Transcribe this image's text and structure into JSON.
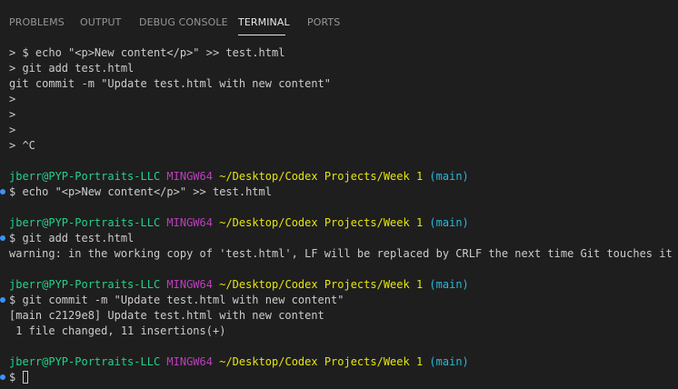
{
  "panel": {
    "tabs": [
      {
        "label": "PROBLEMS"
      },
      {
        "label": "OUTPUT"
      },
      {
        "label": "DEBUG CONSOLE"
      },
      {
        "label": "TERMINAL"
      },
      {
        "label": "PORTS"
      }
    ],
    "active_tab": "TERMINAL"
  },
  "terminal": {
    "continuation": [
      "> $ echo \"<p>New content</p>\" >> test.html",
      "> git add test.html",
      "git commit -m \"Update test.html with new content\"",
      ">",
      ">",
      ">",
      "> ^C"
    ],
    "prompt": {
      "user": "jberr@PYP-Portraits-LLC",
      "env": "MINGW64",
      "path": "~/Desktop/Codex Projects/Week 1",
      "branch": "(main)"
    },
    "blocks": [
      {
        "command": "$ echo \"<p>New content</p>\" >> test.html",
        "output": []
      },
      {
        "command": "$ git add test.html",
        "output": [
          "warning: in the working copy of 'test.html', LF will be replaced by CRLF the next time Git touches it"
        ]
      },
      {
        "command": "$ git commit -m \"Update test.html with new content\"",
        "output": [
          "[main c2129e8] Update test.html with new content",
          " 1 file changed, 11 insertions(+)"
        ]
      }
    ],
    "current_prompt": "$ "
  },
  "colors": {
    "background": "#1e1e1e",
    "text": "#cccccc",
    "user": "#23d18b",
    "env": "#bc3fbc",
    "path": "#e5e510",
    "branch": "#29b8db",
    "marker": "#3794ff"
  }
}
